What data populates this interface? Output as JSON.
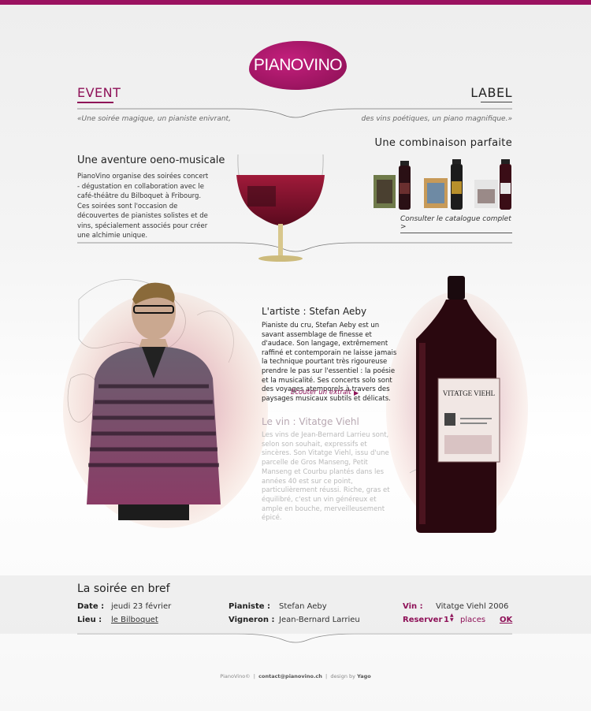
{
  "brand": {
    "name": "PIANOVINO",
    "colors": {
      "accent": "#8e1158",
      "bar": "#9b1260"
    }
  },
  "header": {
    "event": "EVENT",
    "label": "LABEL",
    "quote_left": "«Une soirée magique, un pianiste enivrant,",
    "quote_right": "des vins poétiques, un piano magnifique.»"
  },
  "intro": {
    "title": "Une aventure oeno-musicale",
    "text": "PianoVino organise des soirées concert - dégustation en collaboration avec le café-théâtre du Bilboquet à Fribourg. Ces soirées sont l'occasion de découvertes de pianistes solistes et de vins, spécialement associés pour créer une alchimie unique."
  },
  "combination": {
    "title": "Une combinaison parfaite",
    "catalogue_link": "Consulter le catalogue complet >",
    "bottles": [
      {
        "icon": "wine-bottle-icon",
        "label_color": "#6a2f2f"
      },
      {
        "icon": "wine-bottle-icon",
        "label_color": "#b8902c"
      },
      {
        "icon": "wine-bottle-icon",
        "label_color": "#e8e8e8"
      }
    ]
  },
  "artist": {
    "title": "L'artiste : Stefan Aeby",
    "text": "Pianiste du cru, Stefan Aeby est un savant assemblage de finesse et d'audace. Son langage, extrêmement raffiné et contemporain ne laisse jamais la technique pourtant très rigoureuse prendre le pas sur l'essentiel : la poésie et la musicalité. Ses concerts solo sont des voyages atemporels à travers des paysages musicaux subtils et délicats.",
    "listen_link": "Ecouter un extrait"
  },
  "wine": {
    "title": "Le vin : Vitatge Viehl",
    "text": "Les vins de Jean-Bernard Larrieu sont, selon son souhait, expressifs et sincères. Son Vitatge Viehl, issu d'une parcelle de Gros Manseng, Petit Manseng et Courbu plantés dans les années 40 est sur ce point, particulièrement réussi. Riche, gras et équilibré, c'est un vin généreux et ample en bouche, merveilleusement épicé.",
    "bottle_label": "VITATGE VIEHL"
  },
  "brief": {
    "title": "La soirée en bref",
    "date_label": "Date :",
    "date_value": "jeudi 23 février",
    "lieu_label": "Lieu :",
    "lieu_value": "le Bilboquet",
    "pianiste_label": "Pianiste :",
    "pianiste_value": "Stefan Aeby",
    "vigneron_label": "Vigneron :",
    "vigneron_value": "Jean-Bernard Larrieu",
    "vin_label": "Vin :",
    "vin_value": "Vitatge Viehl 2006",
    "reserver_label": "Reserver",
    "places_count": "1",
    "places_label": "places",
    "ok_label": "OK"
  },
  "footer": {
    "brand": "PianoVino©",
    "email": "contact@pianovino.ch",
    "design_by": "design by",
    "designer": "Yago"
  }
}
